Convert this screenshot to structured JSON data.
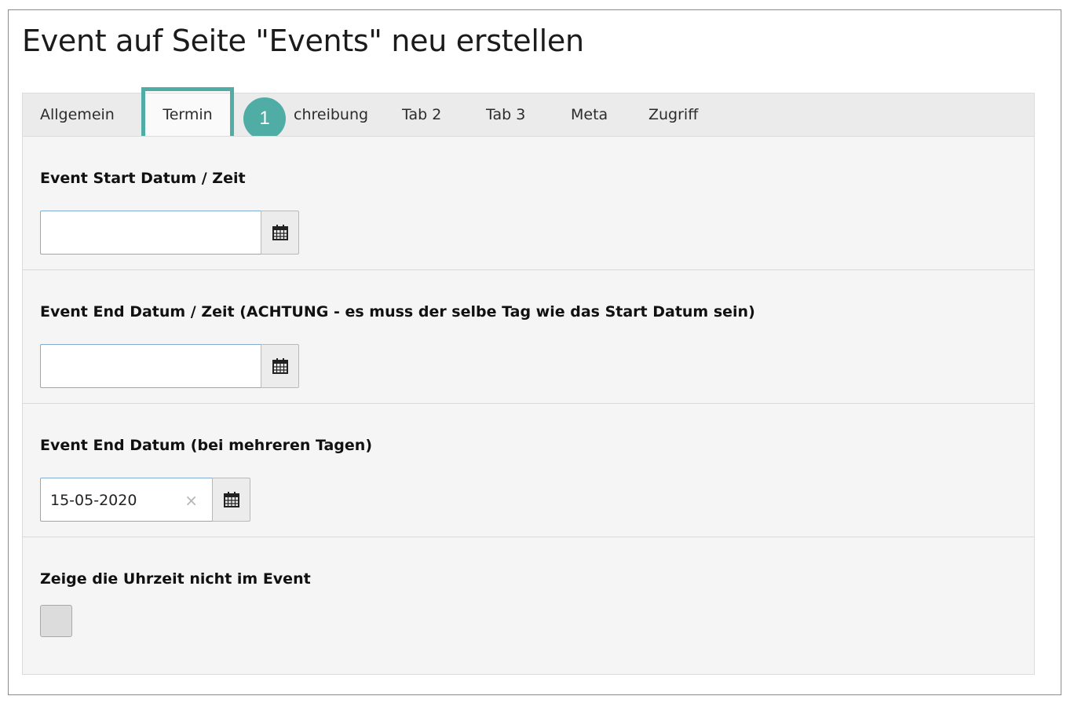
{
  "page": {
    "title": "Event auf Seite \"Events\" neu erstellen"
  },
  "tabs": [
    {
      "label": "Allgemein",
      "active": false
    },
    {
      "label": "Termin",
      "active": true
    },
    {
      "label": "chreibung",
      "active": false
    },
    {
      "label": "Tab 2",
      "active": false
    },
    {
      "label": "Tab 3",
      "active": false
    },
    {
      "label": "Meta",
      "active": false
    },
    {
      "label": "Zugriff",
      "active": false
    }
  ],
  "annotation": {
    "step_number": "1",
    "color": "#4fada5"
  },
  "fields": {
    "start": {
      "label": "Event Start Datum / Zeit",
      "value": "",
      "icon": "calendar-icon"
    },
    "end": {
      "label": "Event End Datum / Zeit (ACHTUNG - es muss der selbe Tag wie das Start Datum sein)",
      "value": "",
      "icon": "calendar-icon"
    },
    "end_date": {
      "label": "Event End Datum (bei mehreren Tagen)",
      "value": "15-05-2020",
      "clear_glyph": "×",
      "icon": "calendar-icon"
    },
    "hide_time": {
      "label": "Zeige die Uhrzeit nicht im Event",
      "checked": false
    }
  }
}
